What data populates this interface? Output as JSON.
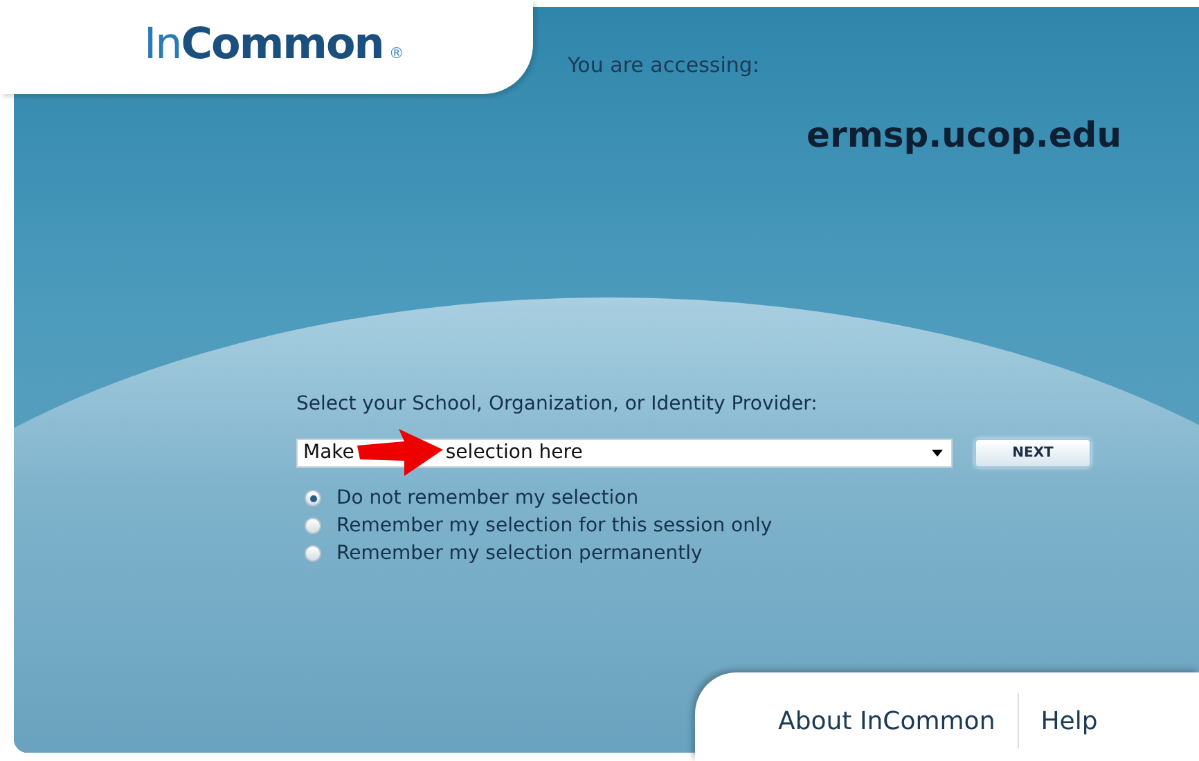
{
  "logo": {
    "light": "In",
    "bold": "Common",
    "mark": "®"
  },
  "accessing": {
    "label": "You are accessing:",
    "host": "ermsp.ucop.edu"
  },
  "form": {
    "label": "Select your School, Organization, or Identity Provider:",
    "select": {
      "value_start": "Make",
      "value_end": "selection here"
    },
    "next_button": "NEXT",
    "options": [
      {
        "label": "Do not remember my selection",
        "selected": true
      },
      {
        "label": "Remember my selection for this session only",
        "selected": false
      },
      {
        "label": "Remember my selection permanently",
        "selected": false
      }
    ]
  },
  "footer_links": [
    "About InCommon",
    "Help"
  ]
}
